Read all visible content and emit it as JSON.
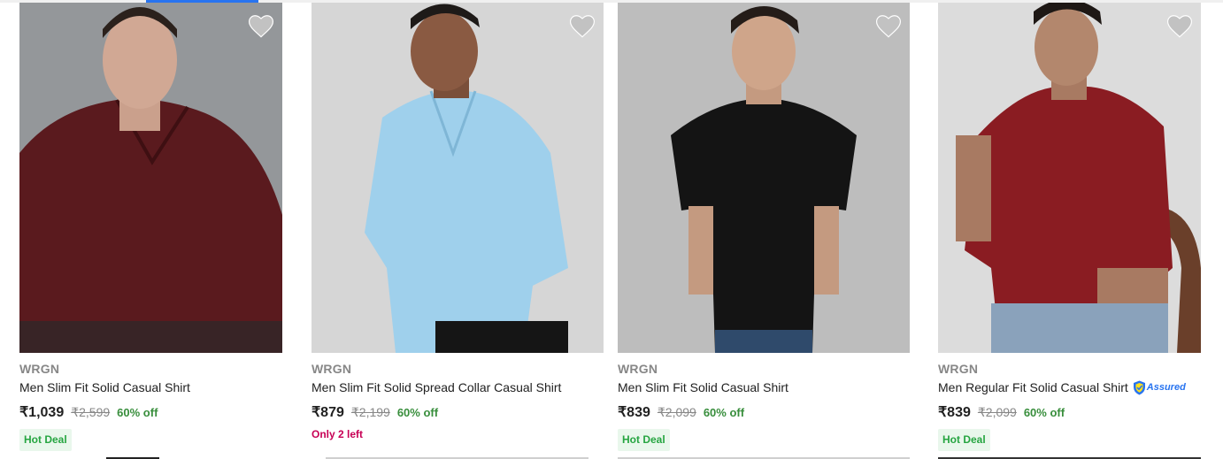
{
  "wishlist_icon": "heart-icon",
  "products": [
    {
      "brand": "WRGN",
      "title": "Men Slim Fit Solid Casual Shirt",
      "price": "₹1,039",
      "mrp": "₹2,599",
      "discount": "60% off",
      "tag": "Hot Deal",
      "shirt_color": "#5a1a1e",
      "bg_color": "#8d8f93"
    },
    {
      "brand": "WRGN",
      "title": "Men Slim Fit Solid Spread Collar Casual Shirt",
      "price": "₹879",
      "mrp": "₹2,199",
      "discount": "60% off",
      "stock_note": "Only 2 left",
      "shirt_color": "#9fd0ec",
      "bg_color": "#d6d6d6"
    },
    {
      "brand": "WRGN",
      "title": "Men Slim Fit Solid Casual Shirt",
      "price": "₹839",
      "mrp": "₹2,099",
      "discount": "60% off",
      "tag": "Hot Deal",
      "shirt_color": "#141414",
      "bg_color": "#bdbdbd"
    },
    {
      "brand": "WRGN",
      "title": "Men Regular Fit Solid Casual Shirt",
      "assured_label": "Assured",
      "price": "₹839",
      "mrp": "₹2,099",
      "discount": "60% off",
      "tag": "Hot Deal",
      "shirt_color": "#8a1c22",
      "bg_color": "#dcdcdc"
    }
  ]
}
